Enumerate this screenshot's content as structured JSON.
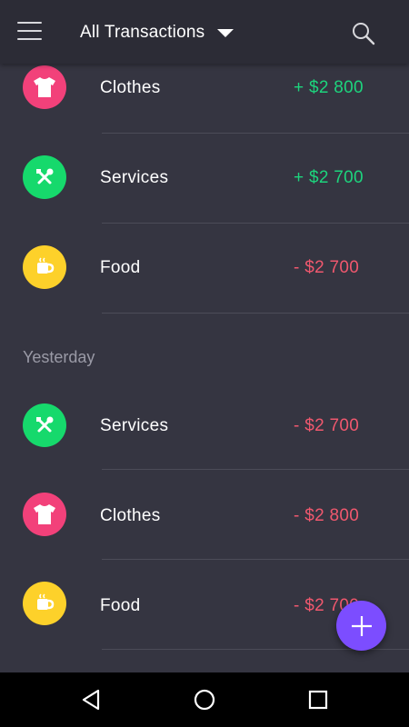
{
  "header": {
    "title": "All Transactions",
    "icons": {
      "menu": "hamburger-menu-icon",
      "dropdown": "caret-down-icon",
      "search": "search-icon"
    }
  },
  "colors": {
    "background": "#353541",
    "appbar": "#2c2c36",
    "positive": "#1dd47d",
    "negative": "#f0586e",
    "clothes": "#f2417a",
    "services": "#16d96c",
    "food": "#fdd12a",
    "fab": "#7c4dff"
  },
  "sections": [
    {
      "header": "",
      "transactions": [
        {
          "category": "Clothes",
          "icon": "tshirt-icon",
          "amount": "+ $2 800",
          "type": "income"
        },
        {
          "category": "Services",
          "icon": "tools-icon",
          "amount": "+ $2 700",
          "type": "income"
        },
        {
          "category": "Food",
          "icon": "mug-icon",
          "amount": "- $2 700",
          "type": "expense"
        }
      ]
    },
    {
      "header": "Yesterday",
      "transactions": [
        {
          "category": "Services",
          "icon": "tools-icon",
          "amount": "- $2 700",
          "type": "expense"
        },
        {
          "category": "Clothes",
          "icon": "tshirt-icon",
          "amount": "- $2 800",
          "type": "expense"
        },
        {
          "category": "Food",
          "icon": "mug-icon",
          "amount": "- $2 700",
          "type": "expense"
        }
      ]
    }
  ],
  "fab": {
    "icon": "plus-icon"
  },
  "navbar": {
    "back": "back-triangle-icon",
    "home": "home-circle-icon",
    "recents": "recents-square-icon"
  }
}
